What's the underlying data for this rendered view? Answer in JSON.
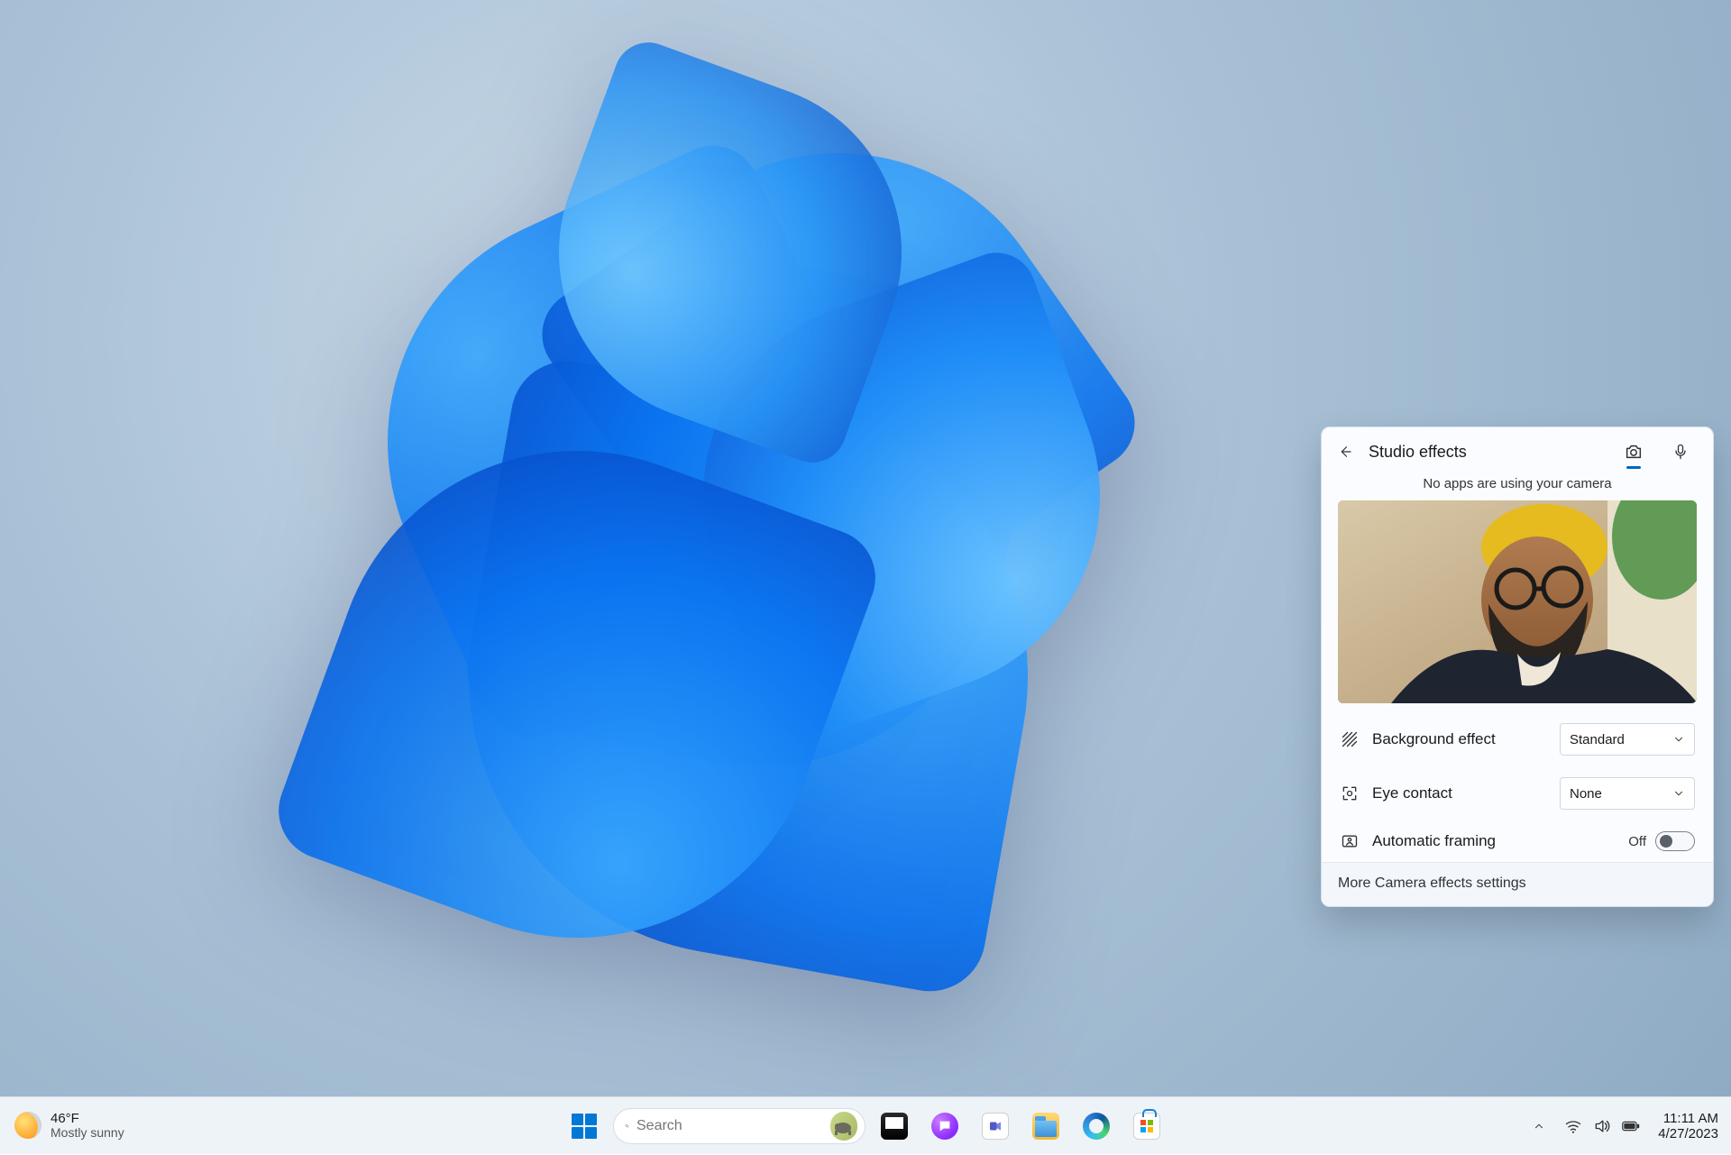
{
  "panel": {
    "title": "Studio effects",
    "status": "No apps are using your camera",
    "rows": {
      "background": {
        "label": "Background effect",
        "value": "Standard"
      },
      "eyecontact": {
        "label": "Eye contact",
        "value": "None"
      },
      "autoframe": {
        "label": "Automatic framing",
        "state_label": "Off"
      }
    },
    "footer": "More Camera effects settings"
  },
  "taskbar": {
    "weather": {
      "temp": "46°F",
      "condition": "Mostly sunny"
    },
    "search_placeholder": "Search",
    "time": "11:11 AM",
    "date": "4/27/2023"
  }
}
